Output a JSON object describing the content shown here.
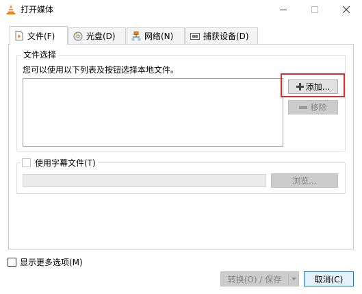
{
  "window": {
    "title": "打开媒体"
  },
  "tabs": [
    {
      "label": "文件(F)",
      "icon": "file-icon"
    },
    {
      "label": "光盘(D)",
      "icon": "disc-icon"
    },
    {
      "label": "网络(N)",
      "icon": "network-icon"
    },
    {
      "label": "捕获设备(D)",
      "icon": "capture-device-icon"
    }
  ],
  "file_selection": {
    "legend": "文件选择",
    "description": "您可以使用以下列表及按钮选择本地文件。",
    "add_label": "添加...",
    "remove_label": "移除"
  },
  "subtitle": {
    "checkbox_label": "使用字幕文件(T)",
    "browse_label": "浏览..."
  },
  "footer": {
    "more_options_label": "显示更多选项(M)",
    "convert_label": "转换(O) / 保存",
    "cancel_label": "取消(C)"
  },
  "colors": {
    "highlight": "#d83030",
    "vlc_orange": "#f58220"
  }
}
